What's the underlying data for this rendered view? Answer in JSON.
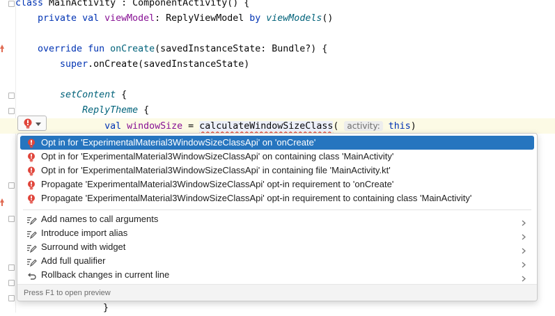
{
  "editor": {
    "lines": [
      {
        "id": "l0",
        "parts": [
          {
            "t": "class ",
            "c": "kw"
          },
          {
            "t": "MainActivity : ComponentActivity() {",
            "c": ""
          }
        ]
      },
      {
        "id": "l1",
        "parts": [
          {
            "t": "    private val ",
            "c": "kw"
          },
          {
            "t": "viewModel",
            "c": "prop"
          },
          {
            "t": ": ReplyViewModel ",
            "c": ""
          },
          {
            "t": "by ",
            "c": "kw"
          },
          {
            "t": "viewModels",
            "c": "fn ital"
          },
          {
            "t": "()",
            "c": ""
          }
        ]
      },
      {
        "id": "l2",
        "parts": []
      },
      {
        "id": "l3",
        "parts": [
          {
            "t": "    override fun ",
            "c": "kw"
          },
          {
            "t": "onCreate",
            "c": "fn"
          },
          {
            "t": "(savedInstanceState: Bundle?) {",
            "c": ""
          }
        ]
      },
      {
        "id": "l4",
        "parts": [
          {
            "t": "        super",
            "c": "kw"
          },
          {
            "t": ".onCreate(savedInstanceState)",
            "c": ""
          }
        ]
      },
      {
        "id": "l5",
        "parts": []
      },
      {
        "id": "l6",
        "parts": [
          {
            "t": "        setContent",
            "c": "fn ital"
          },
          {
            "t": " {",
            "c": ""
          }
        ]
      },
      {
        "id": "l7",
        "parts": [
          {
            "t": "            ReplyTheme",
            "c": "fn ital"
          },
          {
            "t": " {",
            "c": ""
          }
        ]
      },
      {
        "id": "l8",
        "parts": [
          {
            "t": "                val ",
            "c": "kw"
          },
          {
            "t": "windowSize",
            "c": "prop"
          },
          {
            "t": " = ",
            "c": ""
          },
          {
            "t": "calculateWindowSizeClass",
            "c": "err"
          },
          {
            "t": "( ",
            "c": ""
          },
          {
            "t": "activity:",
            "c": "hint"
          },
          {
            "t": " this",
            "c": "kw"
          },
          {
            "t": ")",
            "c": ""
          }
        ]
      }
    ],
    "closing_brace": "}"
  },
  "popup": {
    "items": [
      {
        "label": "Opt in for 'ExperimentalMaterial3WindowSizeClassApi' on 'onCreate'",
        "icon": "error-bulb-icon",
        "selected": true,
        "submenu": false
      },
      {
        "label": "Opt in for 'ExperimentalMaterial3WindowSizeClassApi' on containing class 'MainActivity'",
        "icon": "error-bulb-icon",
        "selected": false,
        "submenu": false
      },
      {
        "label": "Opt in for 'ExperimentalMaterial3WindowSizeClassApi' in containing file 'MainActivity.kt'",
        "icon": "error-bulb-icon",
        "selected": false,
        "submenu": false
      },
      {
        "label": "Propagate 'ExperimentalMaterial3WindowSizeClassApi' opt-in requirement to 'onCreate'",
        "icon": "error-bulb-icon",
        "selected": false,
        "submenu": false
      },
      {
        "label": "Propagate 'ExperimentalMaterial3WindowSizeClassApi' opt-in requirement to containing class 'MainActivity'",
        "icon": "error-bulb-icon",
        "selected": false,
        "submenu": false
      },
      {
        "label": "Add names to call arguments",
        "icon": "intention-pencil-icon",
        "selected": false,
        "submenu": true
      },
      {
        "label": "Introduce import alias",
        "icon": "intention-pencil-icon",
        "selected": false,
        "submenu": true
      },
      {
        "label": "Surround with widget",
        "icon": "intention-pencil-icon",
        "selected": false,
        "submenu": true
      },
      {
        "label": "Add full qualifier",
        "icon": "intention-pencil-icon",
        "selected": false,
        "submenu": true
      },
      {
        "label": "Rollback changes in current line",
        "icon": "rollback-icon",
        "selected": false,
        "submenu": true
      }
    ],
    "footer": "Press F1 to open preview"
  },
  "colors": {
    "selection": "#2675bf",
    "error_red": "#e0453b",
    "keyword": "#0033b3",
    "function": "#00627a",
    "property": "#871094"
  }
}
